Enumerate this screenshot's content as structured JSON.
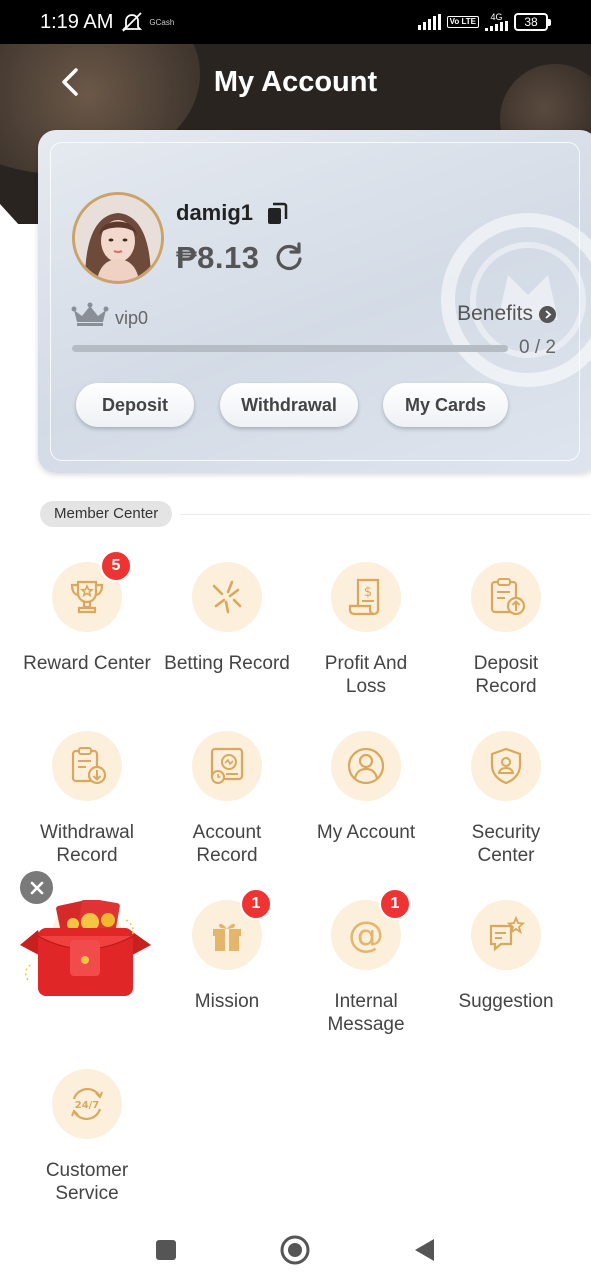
{
  "status_bar": {
    "time": "1:19 AM",
    "gcash_label": "GCash",
    "network": "4G",
    "volte": "Vo LTE",
    "battery": "38"
  },
  "header": {
    "title": "My Account",
    "back_icon": "chevron-left-icon"
  },
  "account": {
    "username": "damig1",
    "balance": "₱8.13",
    "vip_level": "vip0",
    "benefits_label": "Benefits",
    "progress_text": "0 / 2",
    "progress_fraction": 0,
    "buttons": {
      "deposit": "Deposit",
      "withdrawal": "Withdrawal",
      "my_cards": "My Cards"
    }
  },
  "member_center": {
    "title": "Member Center",
    "items": [
      {
        "label": "Reward Center",
        "icon": "trophy-icon",
        "badge": "5"
      },
      {
        "label": "Betting Record",
        "icon": "betting-record-icon",
        "badge": ""
      },
      {
        "label": "Profit And Loss",
        "icon": "invoice-icon",
        "badge": ""
      },
      {
        "label": "Deposit Record",
        "icon": "clipboard-upload-icon",
        "badge": ""
      },
      {
        "label": "Withdrawal Record",
        "icon": "clipboard-download-icon",
        "badge": ""
      },
      {
        "label": "Account Record",
        "icon": "account-record-icon",
        "badge": ""
      },
      {
        "label": "My Account",
        "icon": "user-icon",
        "badge": ""
      },
      {
        "label": "Security Center",
        "icon": "shield-user-icon",
        "badge": ""
      },
      {
        "label": "",
        "icon": "gift-icon",
        "badge": ""
      },
      {
        "label": "Mission",
        "icon": "gift-box-icon",
        "badge": "1"
      },
      {
        "label": "Internal Message",
        "icon": "at-sign-icon",
        "badge": "1"
      },
      {
        "label": "Suggestion",
        "icon": "chat-star-icon",
        "badge": ""
      },
      {
        "label": "Customer Service",
        "icon": "support-24-7-icon",
        "badge": ""
      }
    ]
  },
  "promo": {
    "icon": "red-envelope-icon",
    "close_icon": "close-icon"
  },
  "colors": {
    "accent_gold": "#c9a36a",
    "icon_circle": "#fcefdc",
    "icon_stroke": "#d9a85c",
    "badge": "#e33333",
    "header_bg": "#2a2420"
  }
}
